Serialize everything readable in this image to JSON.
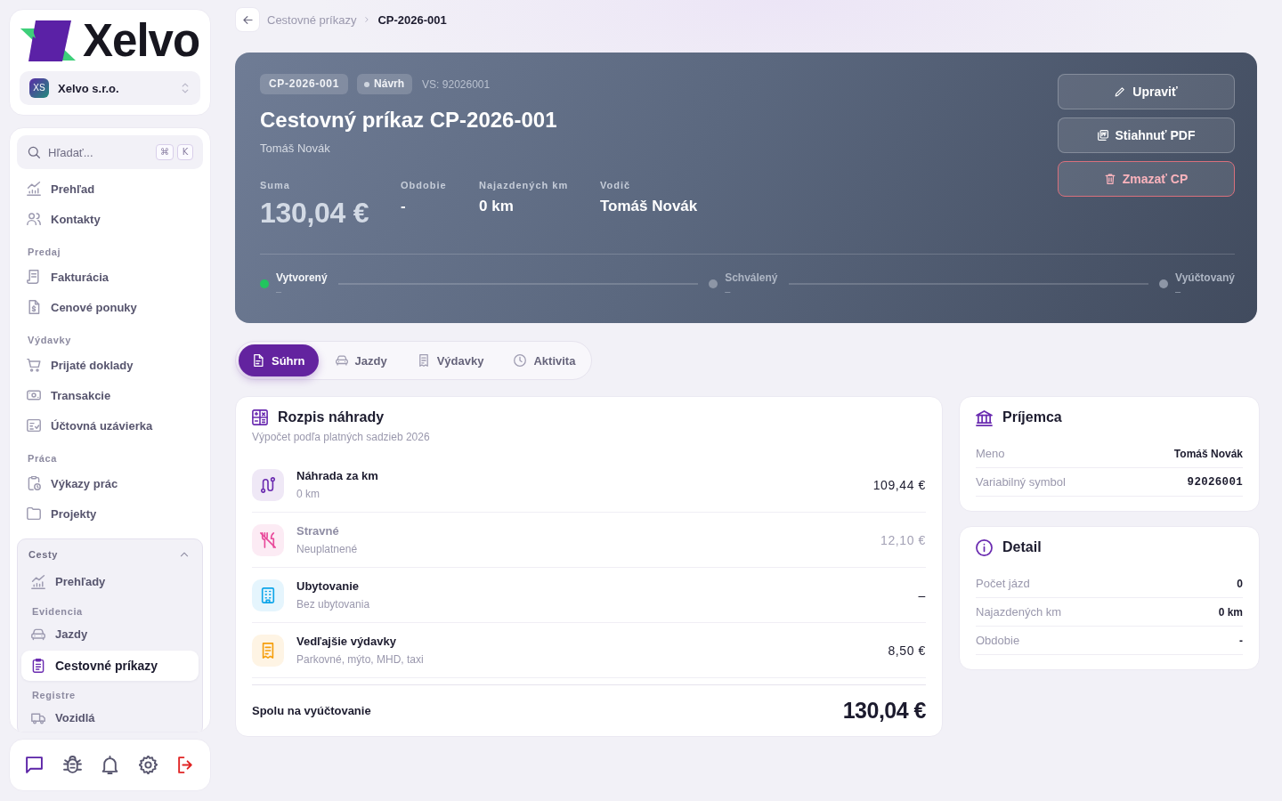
{
  "sidebar": {
    "brand": {
      "name": "Xelvo"
    },
    "organization": {
      "initials": "XS",
      "name": "Xelvo s.r.o."
    },
    "search": {
      "placeholder": "Hľadať...",
      "shortcut": [
        "⌘",
        "K"
      ]
    },
    "nav": [
      {
        "kind": "item",
        "label": "Prehľad",
        "selected": false
      },
      {
        "kind": "item",
        "label": "Kontakty",
        "selected": false
      },
      {
        "kind": "section",
        "label": "Predaj"
      },
      {
        "kind": "item",
        "label": "Fakturácia",
        "selected": false
      },
      {
        "kind": "item",
        "label": "Cenové ponuky",
        "selected": false
      },
      {
        "kind": "section",
        "label": "Výdavky"
      },
      {
        "kind": "item",
        "label": "Prijaté doklady",
        "selected": false
      },
      {
        "kind": "item",
        "label": "Transakcie",
        "selected": false
      },
      {
        "kind": "item",
        "label": "Účtovná uzávierka",
        "selected": false
      },
      {
        "kind": "section",
        "label": "Práca"
      },
      {
        "kind": "item",
        "label": "Výkazy prác",
        "selected": false
      },
      {
        "kind": "item",
        "label": "Projekty",
        "selected": false
      },
      {
        "kind": "group",
        "label": "Cesty",
        "expanded": true,
        "children": [
          {
            "kind": "item",
            "label": "Prehľady",
            "selected": false
          },
          {
            "kind": "section",
            "label": "Evidencia"
          },
          {
            "kind": "item",
            "label": "Jazdy",
            "selected": false
          },
          {
            "kind": "item",
            "label": "Cestovné príkazy",
            "selected": true
          },
          {
            "kind": "section",
            "label": "Registre"
          },
          {
            "kind": "item",
            "label": "Vozidlá",
            "selected": false
          }
        ]
      }
    ]
  },
  "breadcrumb": {
    "parent": "Cestovné príkazy",
    "current": "CP-2026-001"
  },
  "header": {
    "number": "CP-2026-001",
    "status": "Návrh",
    "variable_symbol": "VS: 92026001",
    "title": "Cestovný príkaz CP-2026-001",
    "employee": "Tomáš Novák",
    "stats": [
      {
        "kind": "amount",
        "label": "Suma",
        "value": "130,04 €"
      },
      {
        "kind": "text",
        "label": "Obdobie",
        "value": "-"
      },
      {
        "kind": "text",
        "label": "Najazdených km",
        "value": "0 km"
      },
      {
        "kind": "text",
        "label": "Vodič",
        "value": "Tomáš Novák"
      }
    ],
    "actions": [
      {
        "kind": "edit",
        "label": "Upraviť"
      },
      {
        "kind": "download",
        "label": "Stiahnuť PDF"
      },
      {
        "kind": "delete",
        "label": "Zmazať CP"
      }
    ],
    "timeline": [
      {
        "label": "Vytvorený",
        "date": "–",
        "done": true
      },
      {
        "label": "Schválený",
        "date": "–",
        "done": false
      },
      {
        "label": "Vyúčtovaný",
        "date": "–",
        "done": false
      }
    ]
  },
  "tabs": [
    {
      "label": "Súhrn",
      "selected": true
    },
    {
      "label": "Jazdy",
      "selected": false
    },
    {
      "label": "Výdavky",
      "selected": false
    },
    {
      "label": "Aktivita",
      "selected": false
    }
  ],
  "breakdown": {
    "title": "Rozpis náhrady",
    "subtitle": "Výpočet podľa platných sadzieb 2026",
    "items": [
      {
        "title": "Náhrada za km",
        "detail": "0 km",
        "amount": "109,44 €",
        "applied": true,
        "color": "#6b2bb0"
      },
      {
        "title": "Stravné",
        "detail": "Neuplatnené",
        "amount": "12,10 €",
        "applied": false,
        "color": "#e8489a"
      },
      {
        "title": "Ubytovanie",
        "detail": "Bez ubytovania",
        "amount": "–",
        "applied": true,
        "color": "#0ea5e9"
      },
      {
        "title": "Vedľajšie výdavky",
        "detail": "Parkovné, mýto, MHD, taxi",
        "amount": "8,50 €",
        "applied": true,
        "color": "#f59e0b"
      }
    ],
    "total": {
      "label": "Spolu na vyúčtovanie",
      "value": "130,04 €"
    }
  },
  "recipient": {
    "title": "Príjemca",
    "rows": [
      {
        "kind": "text",
        "label": "Meno",
        "value": "Tomáš Novák"
      },
      {
        "kind": "code",
        "label": "Variabilný symbol",
        "value": "92026001"
      }
    ]
  },
  "detail": {
    "title": "Detail",
    "rows": [
      {
        "label": "Počet jázd",
        "value": "0"
      },
      {
        "label": "Najazdených km",
        "value": "0 km"
      },
      {
        "label": "Obdobie",
        "value": "-"
      }
    ]
  }
}
